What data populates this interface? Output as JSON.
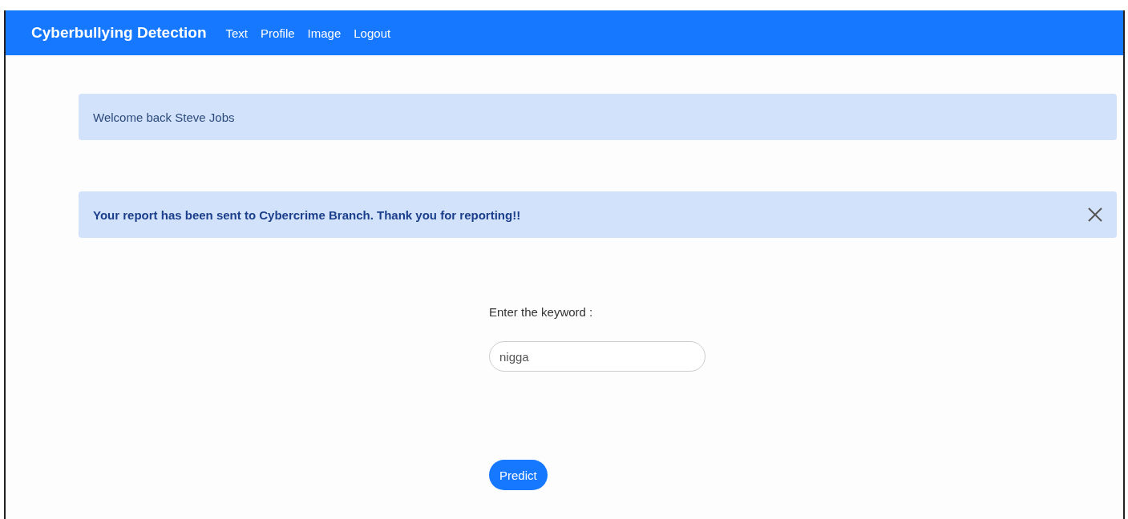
{
  "navbar": {
    "brand": "Cyberbullying Detection",
    "links": [
      {
        "label": "Text"
      },
      {
        "label": "Profile"
      },
      {
        "label": "Image"
      },
      {
        "label": "Logout"
      }
    ]
  },
  "alerts": [
    {
      "kind": "info",
      "text": "Welcome back Steve Jobs",
      "dismissible": false
    },
    {
      "kind": "success",
      "text": "Your report has been sent to Cybercrime Branch. Thank you for reporting!!",
      "dismissible": true
    }
  ],
  "form": {
    "label": "Enter the keyword :",
    "value": "nigga",
    "button": "Predict"
  }
}
